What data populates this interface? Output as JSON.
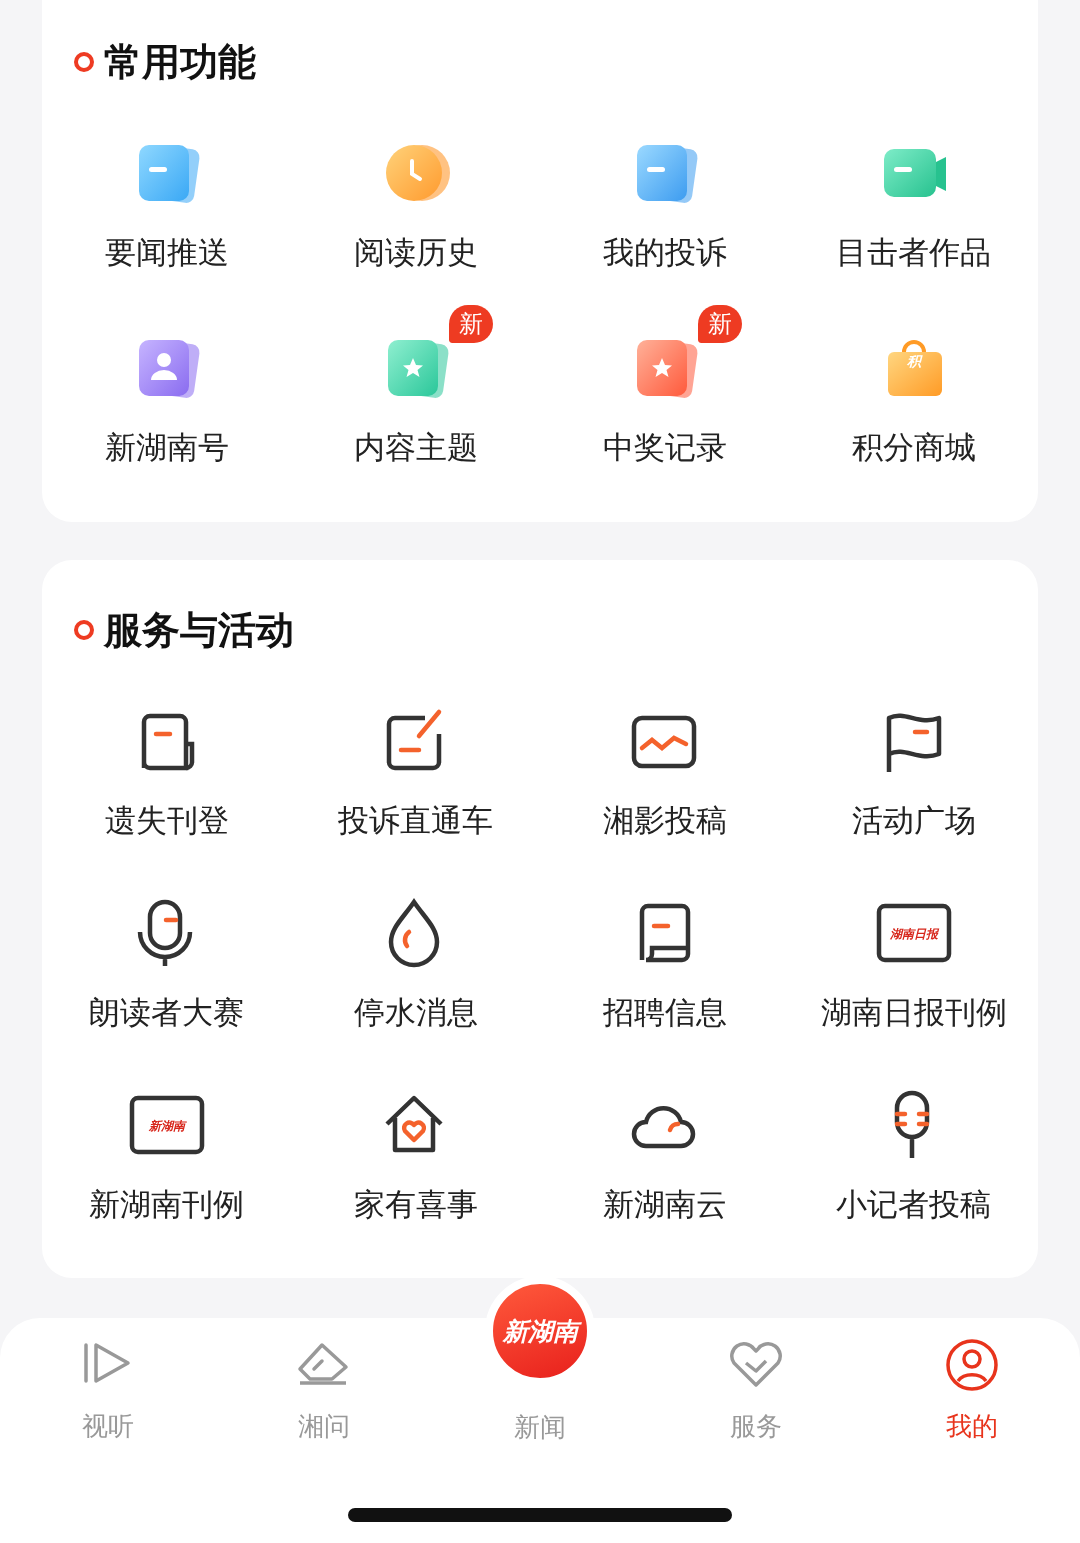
{
  "sections": [
    {
      "title": "常用功能",
      "kind": "color",
      "items": [
        {
          "label": "要闻推送"
        },
        {
          "label": "阅读历史"
        },
        {
          "label": "我的投诉"
        },
        {
          "label": "目击者作品"
        },
        {
          "label": "新湖南号"
        },
        {
          "label": "内容主题",
          "badge": "新"
        },
        {
          "label": "中奖记录",
          "badge": "新"
        },
        {
          "label": "积分商城",
          "icon_text": "积"
        }
      ]
    },
    {
      "title": "服务与活动",
      "kind": "line",
      "items": [
        {
          "label": "遗失刊登"
        },
        {
          "label": "投诉直通车"
        },
        {
          "label": "湘影投稿"
        },
        {
          "label": "活动广场"
        },
        {
          "label": "朗读者大赛"
        },
        {
          "label": "停水消息"
        },
        {
          "label": "招聘信息"
        },
        {
          "label": "湖南日报刊例",
          "icon_text": "湖南日报"
        },
        {
          "label": "新湖南刊例",
          "icon_text": "新湖南"
        },
        {
          "label": "家有喜事"
        },
        {
          "label": "新湖南云"
        },
        {
          "label": "小记者投稿"
        }
      ]
    }
  ],
  "nav": [
    {
      "kind": "tab",
      "label": "视听",
      "selected": false
    },
    {
      "kind": "tab",
      "label": "湘问",
      "selected": false
    },
    {
      "kind": "logo",
      "label": "新闻",
      "logo": "新湖南",
      "selected": false
    },
    {
      "kind": "tab",
      "label": "服务",
      "selected": false
    },
    {
      "kind": "tab",
      "label": "我的",
      "selected": true
    }
  ]
}
